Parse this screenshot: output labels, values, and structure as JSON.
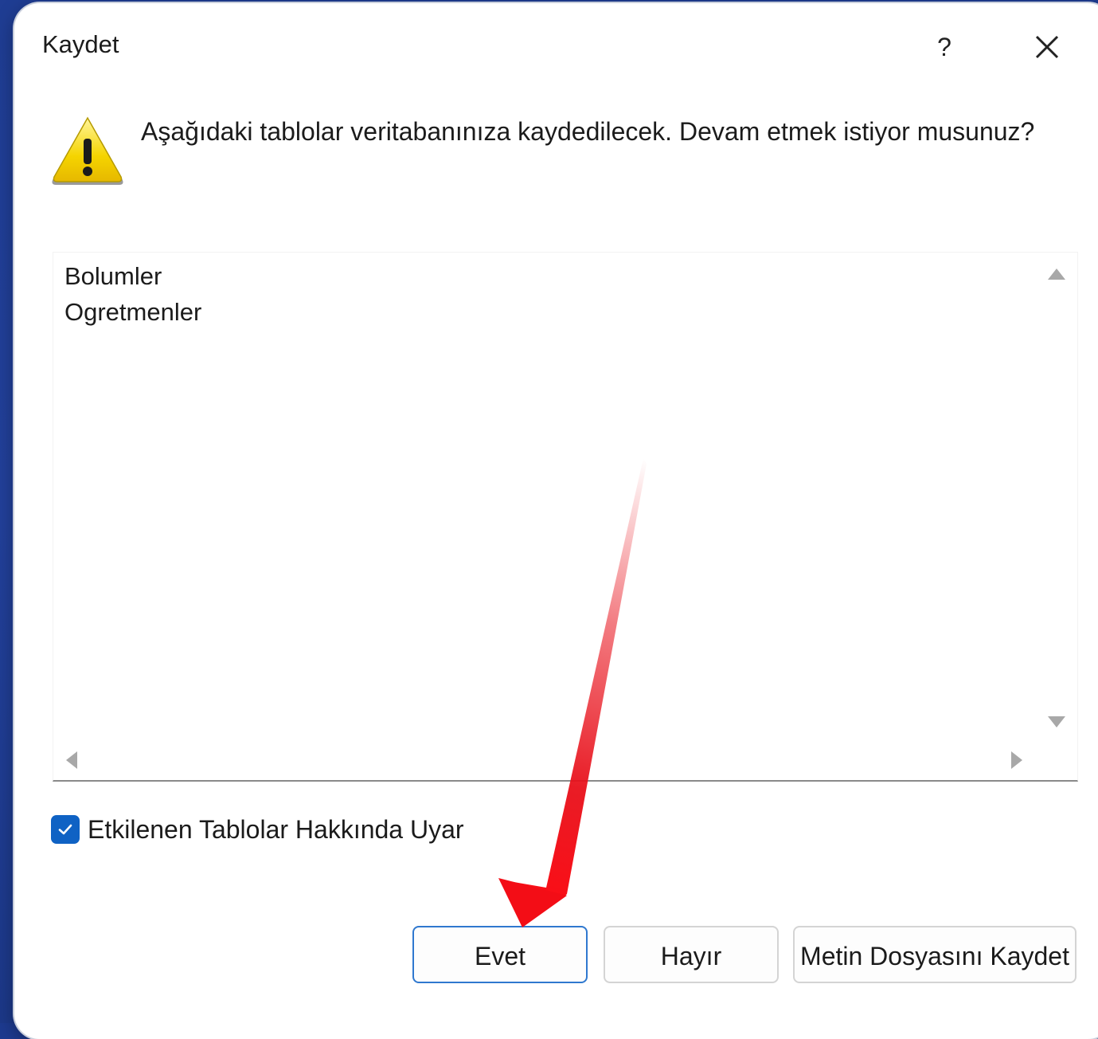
{
  "dialog": {
    "title": "Kaydet",
    "help_label": "?",
    "close_icon": "close-icon",
    "warning_icon": "warning-icon",
    "message": "Aşağıdaki tablolar veritabanınıza kaydedilecek. Devam etmek istiyor musunuz?"
  },
  "table_list": {
    "items": [
      "Bolumler",
      "Ogretmenler"
    ]
  },
  "warn_checkbox": {
    "label": "Etkilenen Tablolar Hakkında Uyar",
    "checked": true
  },
  "buttons": {
    "yes": "Evet",
    "no": "Hayır",
    "save_text_file": "Metin Dosyasını Kaydet"
  },
  "colors": {
    "accent": "#0f62c4",
    "annotation_arrow": "#e8101a",
    "backdrop": "#1f3d93"
  }
}
